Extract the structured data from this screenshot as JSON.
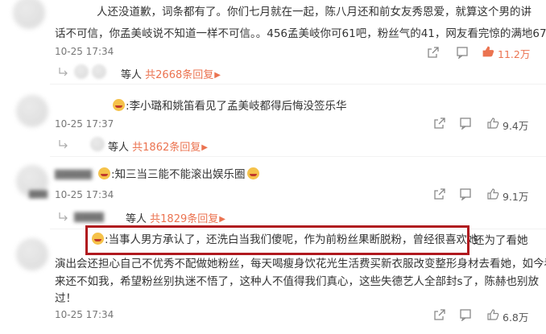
{
  "comments": [
    {
      "text_line1": "人还没道歉，词条都有了。你们七月就在一起，陈八月还和前女友秀恩爱，就算这个男的讲",
      "text_line2": "话不可信，你孟美岐说不知道一样不可信。。456孟美岐你可61吧，粉丝气的41，网友看完惊的满地67。",
      "time": "10-25 17:34",
      "likes": "11.2万",
      "replies_prefix": "等人",
      "replies_count": "共2668条回复"
    },
    {
      "text": "李小璐和姚笛看见了孟美岐都得后悔没签乐华",
      "time": "10-25 17:37",
      "likes": "9.4万",
      "replies_prefix": "等人",
      "replies_count": "共1862条回复"
    },
    {
      "text": "知三当三能不能滚出娱乐圈",
      "time": "10-25 17:34",
      "likes": "9.1万",
      "replies_prefix": "等人",
      "replies_count": "共1829条回复"
    },
    {
      "text_highlight": "当事人男方承认了，还洗白当我们傻呢，作为前粉丝果断脱粉，曾经很喜欢她",
      "text_end1": "还为了看她",
      "text_line2": "演出会还担心自己不优秀不配做她粉丝，每天喝瘦身饮花光生活费买新衣服改变整形身材去看她，如今看",
      "text_line3": "来还不如我，希望粉丝别执迷不悟了，这种人不值得我们真心，这些失德艺人全部封s了，陈赫也别放",
      "text_line4": "过！",
      "time": "10-25 17:34",
      "likes": "6.8万"
    }
  ],
  "colors": {
    "accent": "#eb7350",
    "highlight_border": "#b0191e"
  },
  "icons": [
    "share-icon",
    "comment-icon",
    "like-icon",
    "reply-arrow-icon"
  ]
}
